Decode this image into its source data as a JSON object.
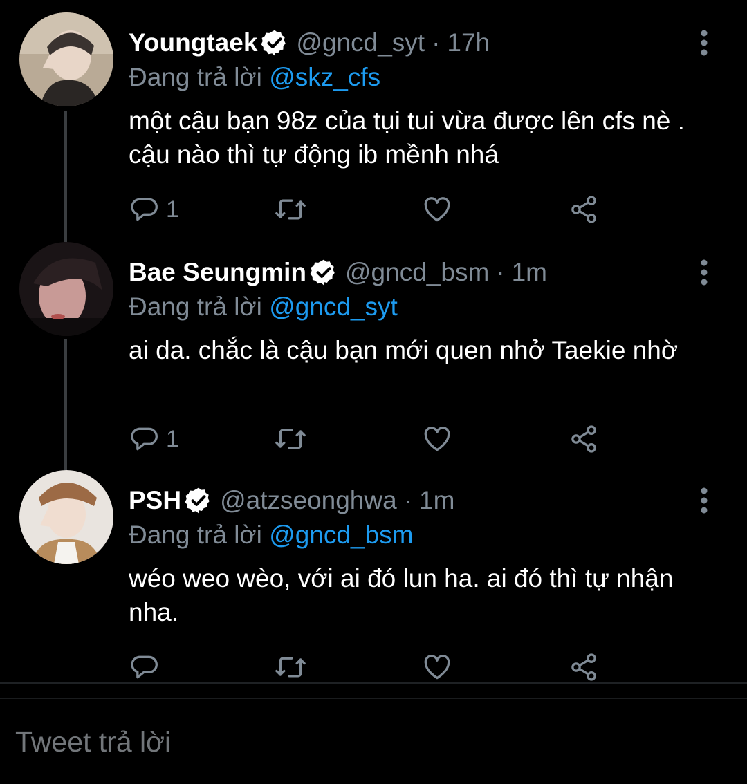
{
  "colors": {
    "background": "#000000",
    "name": "#ffffff",
    "muted": "#808b96",
    "mention": "#1d9bf0",
    "verified_badge": "#ffffff",
    "thread_line": "#3a3d40"
  },
  "tweets": [
    {
      "name": "Youngtaek",
      "handle": "@gncd_syt",
      "separator": "·",
      "time": "17h",
      "replying_prefix": "Đang trả lời",
      "replying_to": "@skz_cfs",
      "text": "một cậu bạn 98z của tụi tui vừa được lên cfs nè . cậu nào thì tự động ib mềnh nhá",
      "reply_count": "1",
      "icons": [
        "reply-icon",
        "retweet-icon",
        "like-icon",
        "share-icon",
        "more-icon"
      ]
    },
    {
      "name": "Bae Seungmin",
      "handle": "@gncd_bsm",
      "separator": "·",
      "time": "1m",
      "replying_prefix": "Đang trả lời",
      "replying_to": "@gncd_syt",
      "text": "ai da. chắc là cậu bạn mới quen nhở Taekie nhờ",
      "reply_count": "1",
      "icons": [
        "reply-icon",
        "retweet-icon",
        "like-icon",
        "share-icon",
        "more-icon"
      ]
    },
    {
      "name": "PSH",
      "handle": "@atzseonghwa",
      "separator": "·",
      "time": "1m",
      "replying_prefix": "Đang trả lời",
      "replying_to": "@gncd_bsm",
      "text": "wéo weo wèo, với ai đó lun ha. ai đó thì tự nhận nha.",
      "reply_count": "",
      "icons": [
        "reply-icon",
        "retweet-icon",
        "like-icon",
        "share-icon",
        "more-icon"
      ]
    }
  ],
  "composer": {
    "placeholder": "Tweet trả lời"
  }
}
